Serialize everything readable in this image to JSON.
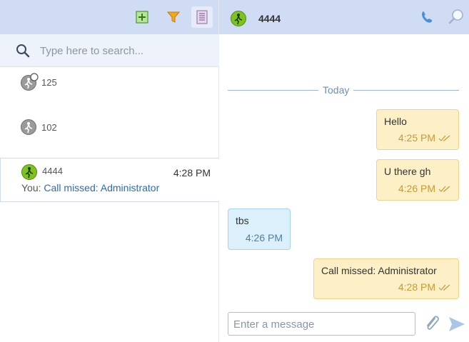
{
  "toolbar": {
    "icons": [
      "add-icon",
      "filter-icon",
      "list-icon"
    ]
  },
  "search": {
    "placeholder": "Type here to search..."
  },
  "contacts": [
    {
      "name": "125",
      "status": "offline"
    },
    {
      "name": "102",
      "status": "offline"
    },
    {
      "name": "4444",
      "status": "online",
      "time": "4:28 PM",
      "preview_prefix": "You: ",
      "preview_text": "Call missed: Administrator"
    }
  ],
  "chat": {
    "name": "4444",
    "divider": "Today",
    "messages": [
      {
        "direction": "out",
        "text": "Hello",
        "time": "4:25 PM",
        "read": true
      },
      {
        "direction": "out",
        "text": "U there gh",
        "time": "4:26 PM",
        "read": true
      },
      {
        "direction": "in",
        "text": "tbs",
        "time": "4:26 PM"
      },
      {
        "direction": "out",
        "text": "Call missed: Administrator",
        "time": "4:28 PM",
        "read": true
      }
    ],
    "composer_placeholder": "Enter a message"
  },
  "colors": {
    "header_bg": "#cfdcf3",
    "online": "#7ec21f",
    "outgoing_bubble": "#fdf0c6",
    "incoming_bubble": "#dcf0fb"
  }
}
